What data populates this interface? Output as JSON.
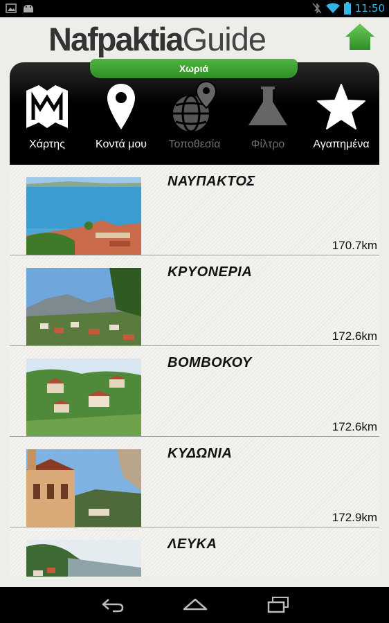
{
  "status_bar": {
    "time": "11:50",
    "left_icons": [
      "image-notification-icon",
      "android-notification-icon"
    ],
    "right_icons": [
      "bluetooth-off-icon",
      "wifi-icon",
      "battery-icon"
    ]
  },
  "header": {
    "logo_bold": "Nafpaktia",
    "logo_light": "Guide",
    "home_icon": "home-icon"
  },
  "section": {
    "title": "Χωριά"
  },
  "toolbar": {
    "items": [
      {
        "label": "Χάρτης",
        "icon": "map-icon",
        "enabled": true
      },
      {
        "label": "Κοντά μου",
        "icon": "location-pin-icon",
        "enabled": true
      },
      {
        "label": "Τοποθεσία",
        "icon": "globe-pin-icon",
        "enabled": false
      },
      {
        "label": "Φίλτρο",
        "icon": "flask-icon",
        "enabled": false
      },
      {
        "label": "Αγαπημένα",
        "icon": "star-icon",
        "enabled": true
      }
    ]
  },
  "villages": [
    {
      "name": "ΝΑΥΠΑΚΤΟΣ",
      "distance": "170.7km"
    },
    {
      "name": "ΚΡΥΟΝΕΡΙΑ",
      "distance": "172.6km"
    },
    {
      "name": "ΒΟΜΒΟΚΟΥ",
      "distance": "172.6km"
    },
    {
      "name": "ΚΥΔΩΝΙΑ",
      "distance": "172.9km"
    },
    {
      "name": "ΛΕΥΚΑ",
      "distance": ""
    }
  ],
  "nav_bar": {
    "buttons": [
      "back-icon",
      "home-nav-icon",
      "recent-apps-icon"
    ]
  },
  "colors": {
    "accent_green": "#3fa535",
    "toolbar_black": "#000000",
    "status_blue": "#33b5e5"
  }
}
